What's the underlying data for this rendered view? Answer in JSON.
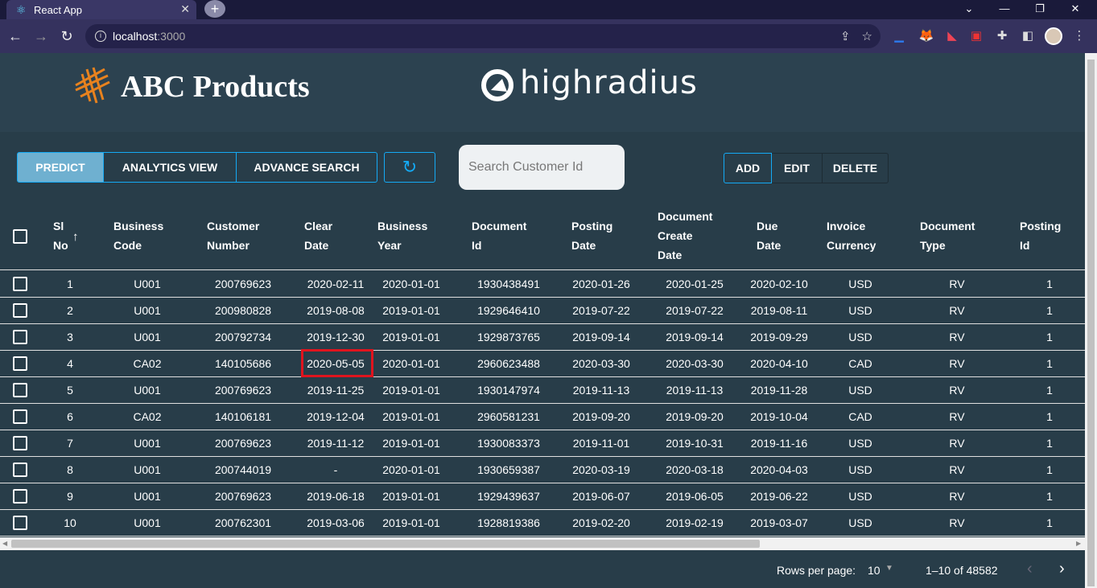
{
  "browser": {
    "tab_title": "React App",
    "url_host": "localhost",
    "url_port": ":3000"
  },
  "header": {
    "brand": "ABC Products",
    "partner": "highradius"
  },
  "toolbar": {
    "tabs": [
      "PREDICT",
      "ANALYTICS VIEW",
      "ADVANCE SEARCH"
    ],
    "search_placeholder": "Search Customer Id",
    "actions": [
      "ADD",
      "EDIT",
      "DELETE"
    ]
  },
  "table": {
    "columns": [
      [
        "Sl",
        "No"
      ],
      [
        "Business",
        "Code"
      ],
      [
        "Customer",
        "Number"
      ],
      [
        "Clear",
        "Date"
      ],
      [
        "Business",
        "Year"
      ],
      [
        "Document",
        "Id"
      ],
      [
        "Posting",
        "Date"
      ],
      [
        "Document",
        "Create",
        "Date"
      ],
      [
        "Due",
        "Date"
      ],
      [
        "Invoice",
        "Currency"
      ],
      [
        "Document",
        "Type"
      ],
      [
        "Posting",
        "Id"
      ]
    ],
    "rows": [
      [
        "1",
        "U001",
        "200769623",
        "2020-02-11",
        "2020-01-01",
        "1930438491",
        "2020-01-26",
        "2020-01-25",
        "2020-02-10",
        "USD",
        "RV",
        "1"
      ],
      [
        "2",
        "U001",
        "200980828",
        "2019-08-08",
        "2019-01-01",
        "1929646410",
        "2019-07-22",
        "2019-07-22",
        "2019-08-11",
        "USD",
        "RV",
        "1"
      ],
      [
        "3",
        "U001",
        "200792734",
        "2019-12-30",
        "2019-01-01",
        "1929873765",
        "2019-09-14",
        "2019-09-14",
        "2019-09-29",
        "USD",
        "RV",
        "1"
      ],
      [
        "4",
        "CA02",
        "140105686",
        "2020-05-05",
        "2020-01-01",
        "2960623488",
        "2020-03-30",
        "2020-03-30",
        "2020-04-10",
        "CAD",
        "RV",
        "1"
      ],
      [
        "5",
        "U001",
        "200769623",
        "2019-11-25",
        "2019-01-01",
        "1930147974",
        "2019-11-13",
        "2019-11-13",
        "2019-11-28",
        "USD",
        "RV",
        "1"
      ],
      [
        "6",
        "CA02",
        "140106181",
        "2019-12-04",
        "2019-01-01",
        "2960581231",
        "2019-09-20",
        "2019-09-20",
        "2019-10-04",
        "CAD",
        "RV",
        "1"
      ],
      [
        "7",
        "U001",
        "200769623",
        "2019-11-12",
        "2019-01-01",
        "1930083373",
        "2019-11-01",
        "2019-10-31",
        "2019-11-16",
        "USD",
        "RV",
        "1"
      ],
      [
        "8",
        "U001",
        "200744019",
        "-",
        "2020-01-01",
        "1930659387",
        "2020-03-19",
        "2020-03-18",
        "2020-04-03",
        "USD",
        "RV",
        "1"
      ],
      [
        "9",
        "U001",
        "200769623",
        "2019-06-18",
        "2019-01-01",
        "1929439637",
        "2019-06-07",
        "2019-06-05",
        "2019-06-22",
        "USD",
        "RV",
        "1"
      ],
      [
        "10",
        "U001",
        "200762301",
        "2019-03-06",
        "2019-01-01",
        "1928819386",
        "2019-02-20",
        "2019-02-19",
        "2019-03-07",
        "USD",
        "RV",
        "1"
      ]
    ]
  },
  "pagination": {
    "rows_label": "Rows per page:",
    "rows_value": "10",
    "range": "1–10 of 48582"
  },
  "colors": {
    "accent": "#14aaf5",
    "active_tab": "#6fb0d0",
    "highlight": "#e0141e"
  }
}
